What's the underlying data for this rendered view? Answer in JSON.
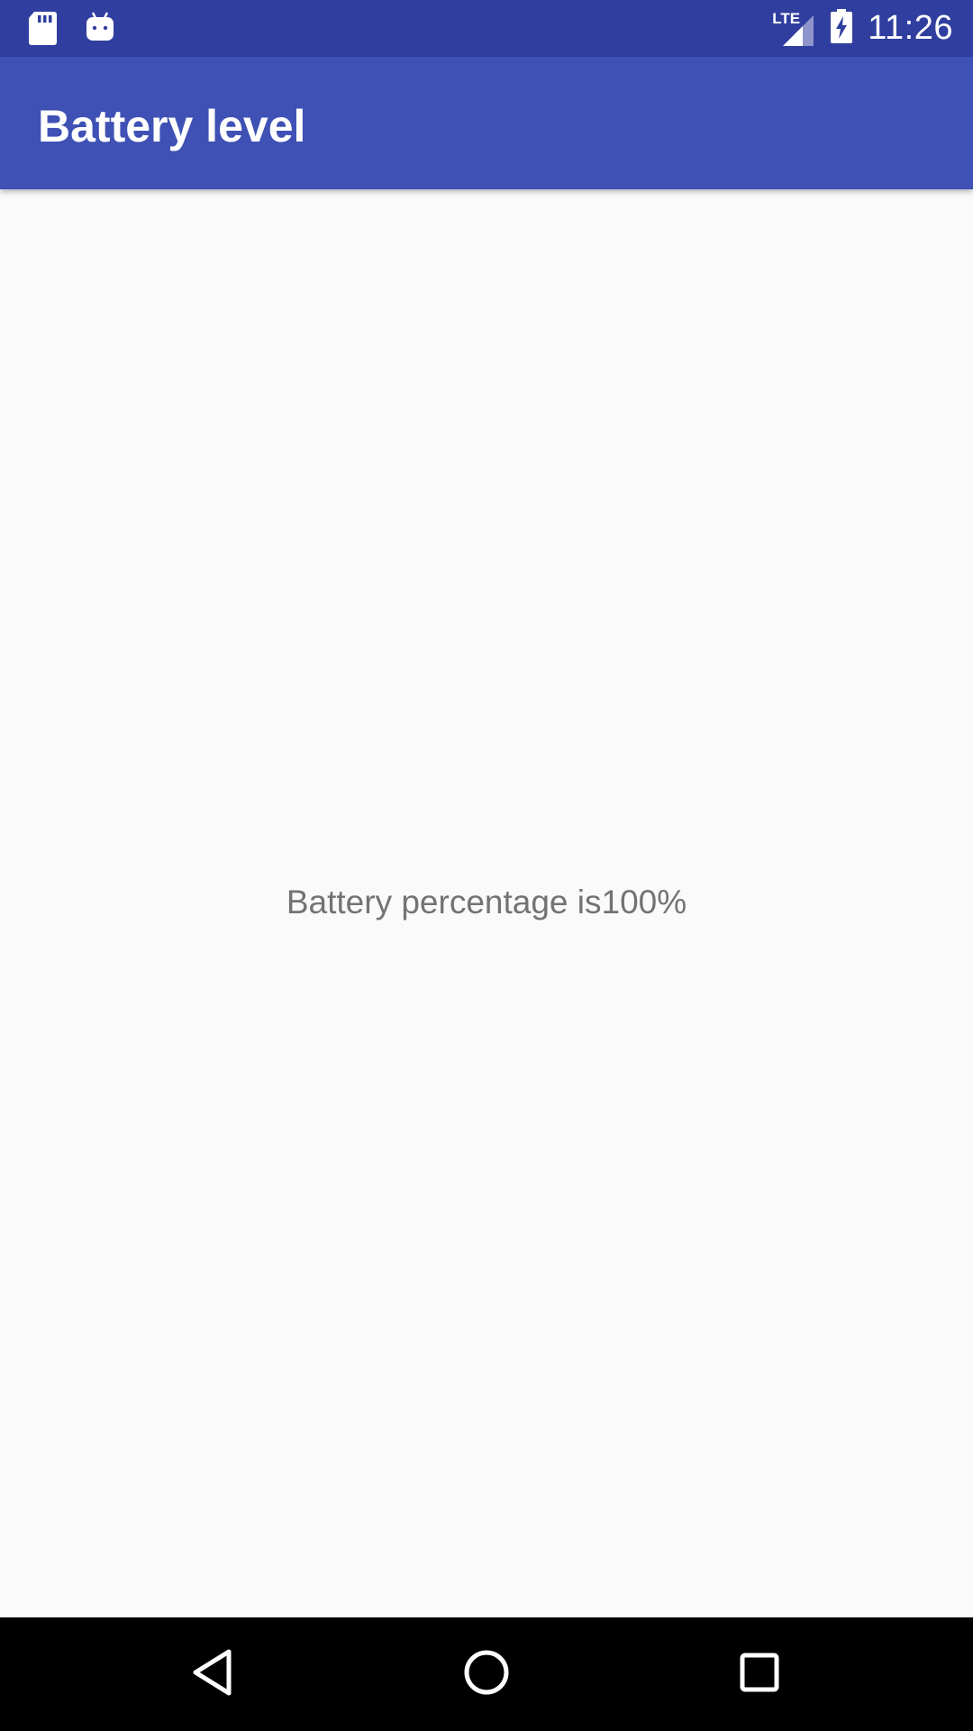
{
  "status_bar": {
    "time": "11:26",
    "network_label": "LTE",
    "icons": [
      "sd-card-icon",
      "android-icon",
      "lte-signal-icon",
      "battery-charging-icon"
    ],
    "color": "#303F9F"
  },
  "app_bar": {
    "title": "Battery level",
    "color": "#3F51B5"
  },
  "main": {
    "battery_text": "Battery percentage is100%",
    "text_color": "#737373",
    "background": "#FAFAFA"
  },
  "nav_bar": {
    "buttons": [
      "back-icon",
      "home-icon",
      "recents-icon"
    ]
  }
}
